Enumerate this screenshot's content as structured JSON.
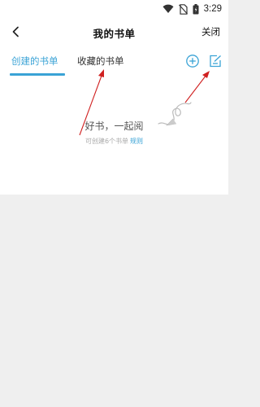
{
  "status_bar": {
    "time": "3:29",
    "icons": [
      "wifi-icon",
      "sim-off-icon",
      "battery-icon"
    ]
  },
  "nav": {
    "back_icon": "chevron-left-icon",
    "title": "我的书单",
    "close_label": "关闭"
  },
  "tabs": [
    {
      "label": "创建的书单",
      "active": true
    },
    {
      "label": "收藏的书单",
      "active": false
    }
  ],
  "actions": {
    "add_icon": "plus-circle-icon",
    "edit_icon": "edit-note-icon"
  },
  "empty_state": {
    "title": "好书，一起阅",
    "subtitle": "可创建6个书单",
    "rules_link": "规则"
  },
  "colors": {
    "accent": "#3aa3d6",
    "annotation_arrow": "#d02020",
    "background": "#efefef"
  }
}
